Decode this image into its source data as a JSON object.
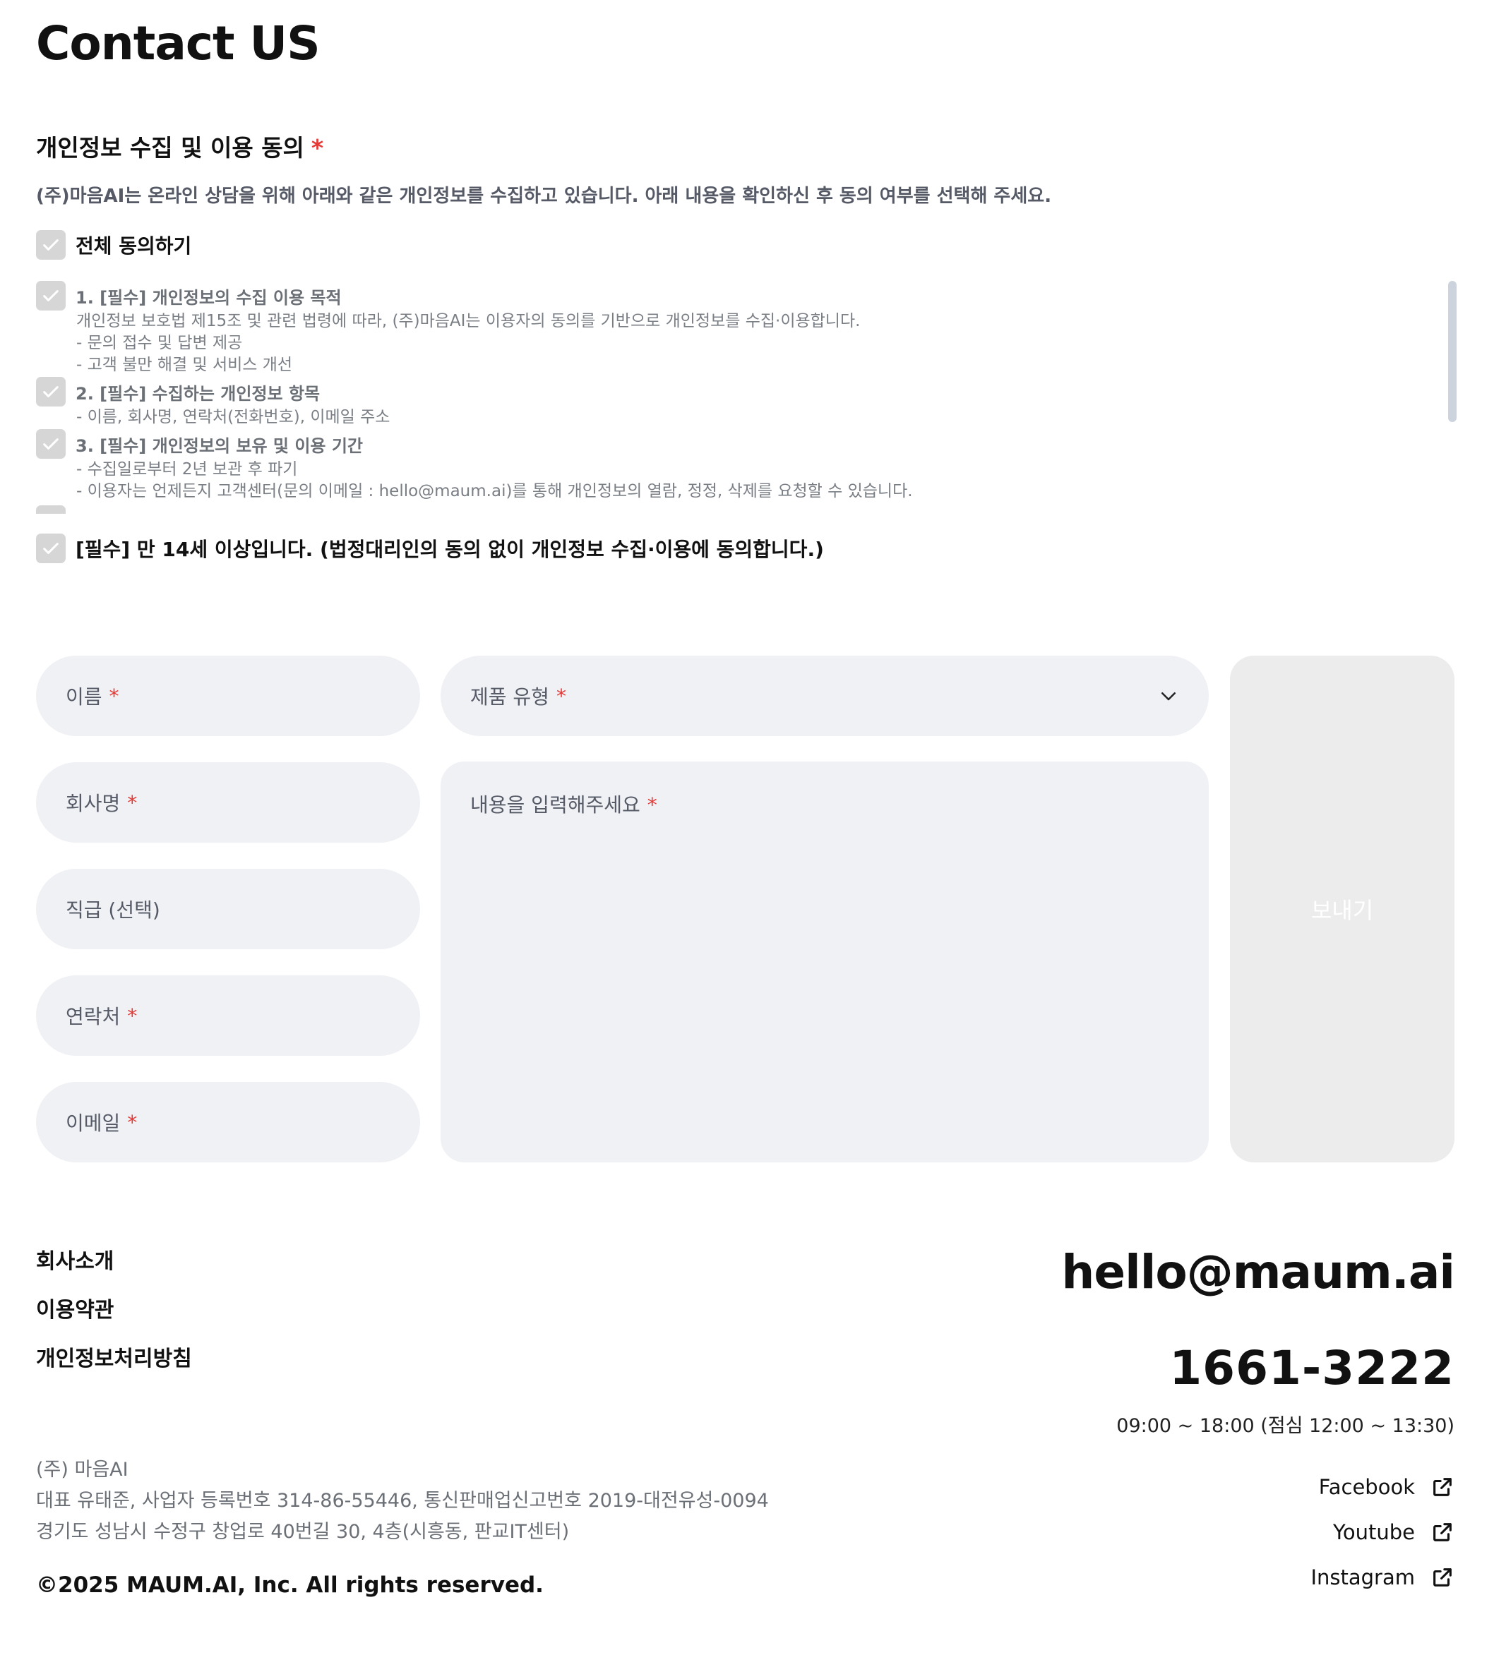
{
  "page": {
    "title": "Contact US"
  },
  "consent": {
    "heading": "개인정보 수집 및 이용 동의",
    "required_mark": "*",
    "description": "(주)마음AI는 온라인 상담을 위해 아래와 같은 개인정보를 수집하고 있습니다. 아래 내용을 확인하신 후 동의 여부를 선택해 주세요.",
    "agree_all": "전체 동의하기",
    "terms": [
      {
        "title": "1. [필수] 개인정보의 수집 이용 목적",
        "lines": [
          "개인정보 보호법 제15조 및 관련 법령에 따라, (주)마음AI는 이용자의 동의를 기반으로 개인정보를 수집·이용합니다.",
          "- 문의 접수 및 답변 제공",
          "- 고객 불만 해결 및 서비스 개선"
        ]
      },
      {
        "title": "2. [필수] 수집하는 개인정보 항목",
        "lines": [
          "- 이름, 회사명, 연락처(전화번호), 이메일 주소"
        ]
      },
      {
        "title": "3. [필수] 개인정보의 보유 및 이용 기간",
        "lines": [
          "- 수집일로부터 2년 보관 후 파기",
          "- 이용자는 언제든지 고객센터(문의 이메일 : hello@maum.ai)를 통해 개인정보의 열람, 정정, 삭제를 요청할 수 있습니다."
        ]
      }
    ],
    "age_confirm": "[필수] 만 14세 이상입니다. (법정대리인의 동의 없이 개인정보 수집·이용에 동의합니다.)"
  },
  "form": {
    "name_placeholder": "이름",
    "company_placeholder": "회사명",
    "position_placeholder": "직급 (선택)",
    "phone_placeholder": "연락처",
    "email_placeholder": "이메일",
    "product_type_placeholder": "제품 유형",
    "content_placeholder": "내용을 입력해주세요",
    "required_mark": "*",
    "send_label": "보내기"
  },
  "footer": {
    "links": [
      "회사소개",
      "이용약관",
      "개인정보처리방침"
    ],
    "email": "hello@maum.ai",
    "phone": "1661-3222",
    "hours": "09:00 ~ 18:00 (점심 12:00 ~ 13:30)",
    "company_lines": [
      "(주) 마음AI",
      "대표 유태준, 사업자 등록번호 314-86-55446, 통신판매업신고번호 2019-대전유성-0094",
      "경기도 성남시 수정구 창업로 40번길 30, 4층(시흥동, 판교IT센터)"
    ],
    "copyright": "©2025 MAUM.AI, Inc. All rights reserved.",
    "social": [
      "Facebook",
      "Youtube",
      "Instagram"
    ]
  }
}
